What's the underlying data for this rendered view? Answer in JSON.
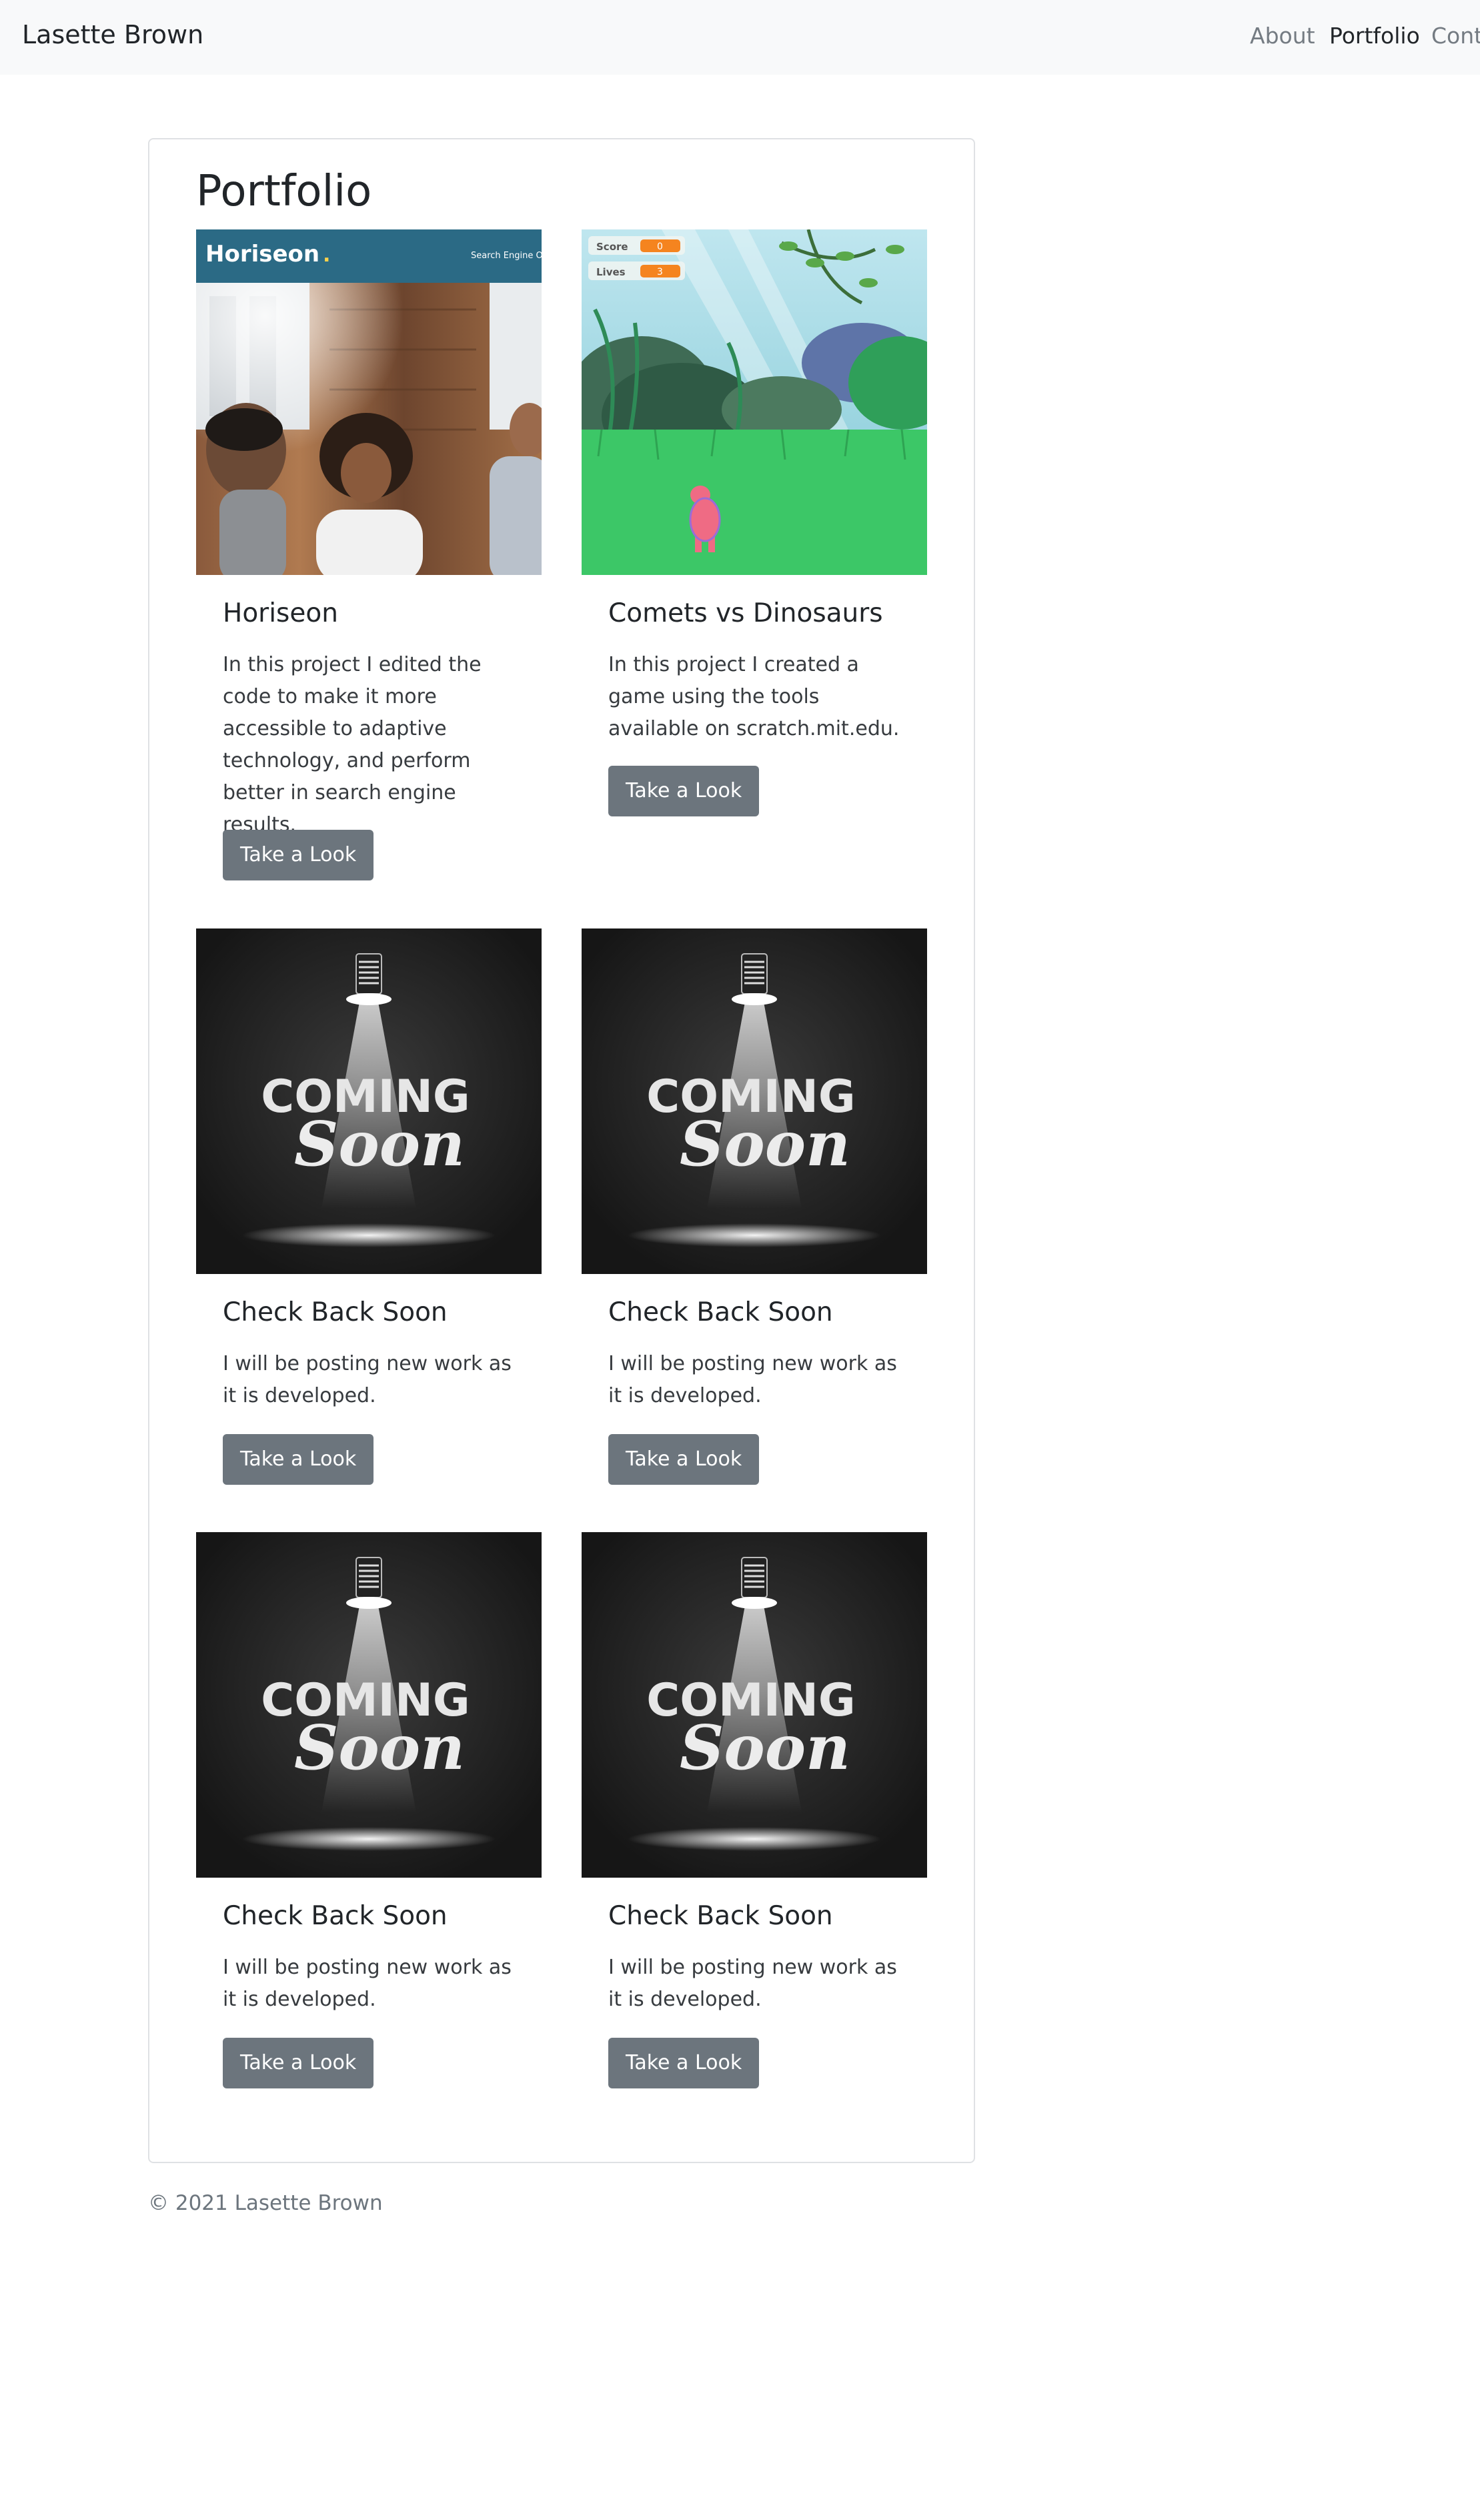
{
  "nav": {
    "brand": "Lasette Brown",
    "links": [
      {
        "label": "About"
      },
      {
        "label": "Portfolio",
        "active": true
      },
      {
        "label": "Contact"
      }
    ]
  },
  "page": {
    "title": "Portfolio"
  },
  "projects": [
    {
      "title": "Horiseon",
      "description": "In this project I edited the code to make it more accessible to adaptive technology, and perform better in search engine results.",
      "button": "Take a Look",
      "image": {
        "kind": "horiseon-screenshot",
        "header_logo": "Horiseon",
        "header_logo_suffix": ".",
        "header_tagline": "Search Engine O"
      }
    },
    {
      "title": "Comets vs Dinosaurs",
      "description": "In this project I created a game using the tools available on scratch.mit.edu.",
      "button": "Take a Look",
      "image": {
        "kind": "scratch-game-screenshot",
        "score_label": "Score",
        "score_value": "0",
        "lives_label": "Lives",
        "lives_value": "3"
      }
    },
    {
      "title": "Check Back Soon",
      "description": "I will be posting new work as it is developed.",
      "button": "Take a Look",
      "image": {
        "kind": "coming-soon",
        "line1": "COMING",
        "line2": "Soon"
      }
    },
    {
      "title": "Check Back Soon",
      "description": "I will be posting new work as it is developed.",
      "button": "Take a Look",
      "image": {
        "kind": "coming-soon",
        "line1": "COMING",
        "line2": "Soon"
      }
    },
    {
      "title": "Check Back Soon",
      "description": "I will be posting new work as it is developed.",
      "button": "Take a Look",
      "image": {
        "kind": "coming-soon",
        "line1": "COMING",
        "line2": "Soon"
      }
    },
    {
      "title": "Check Back Soon",
      "description": "I will be posting new work as it is developed.",
      "button": "Take a Look",
      "image": {
        "kind": "coming-soon",
        "line1": "COMING",
        "line2": "Soon"
      }
    }
  ],
  "footer": {
    "text": "© 2021 Lasette Brown"
  },
  "colors": {
    "navbar_bg": "#f8f9fa",
    "button_bg": "#6c757d",
    "text": "#212529",
    "muted": "#6c757d",
    "card_border": "#dfe1e4"
  }
}
